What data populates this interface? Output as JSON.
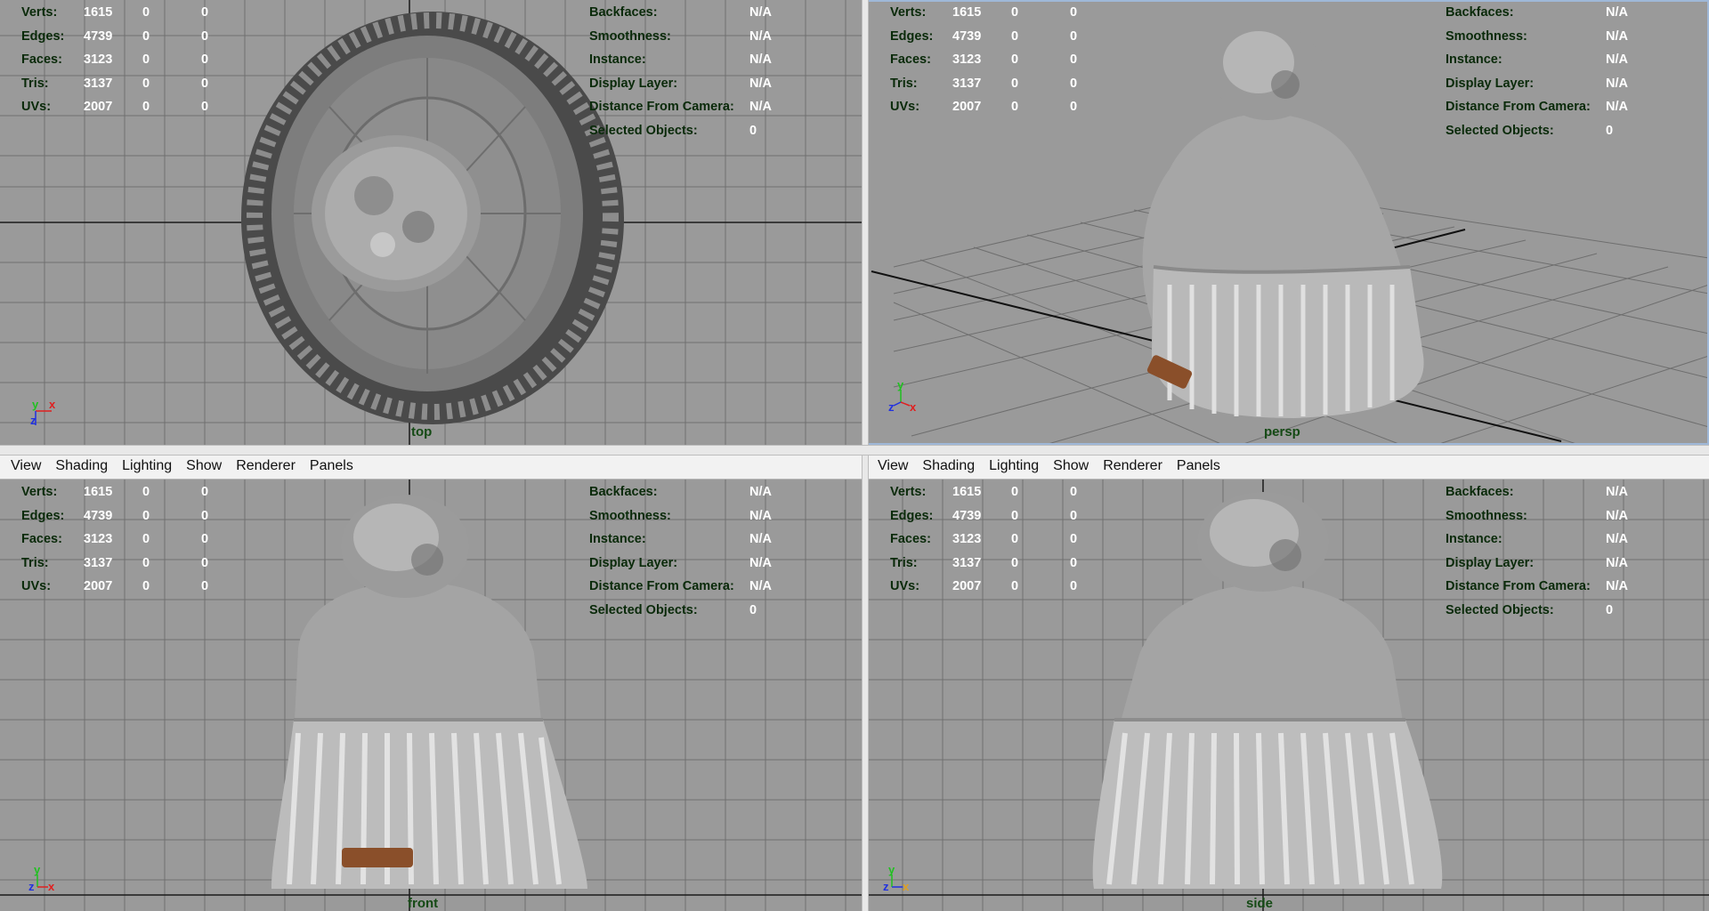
{
  "menu": [
    "View",
    "Shading",
    "Lighting",
    "Show",
    "Renderer",
    "Panels"
  ],
  "hud_left": [
    {
      "label": "Verts:",
      "v1": "1615",
      "v2": "0",
      "v3": "0"
    },
    {
      "label": "Edges:",
      "v1": "4739",
      "v2": "0",
      "v3": "0"
    },
    {
      "label": "Faces:",
      "v1": "3123",
      "v2": "0",
      "v3": "0"
    },
    {
      "label": "Tris:",
      "v1": "3137",
      "v2": "0",
      "v3": "0"
    },
    {
      "label": "UVs:",
      "v1": "2007",
      "v2": "0",
      "v3": "0"
    }
  ],
  "hud_right": [
    {
      "label": "Backfaces:",
      "value": "N/A"
    },
    {
      "label": "Smoothness:",
      "value": "N/A"
    },
    {
      "label": "Instance:",
      "value": "N/A"
    },
    {
      "label": "Display Layer:",
      "value": "N/A"
    },
    {
      "label": "Distance From Camera:",
      "value": "N/A"
    },
    {
      "label": "Selected Objects:",
      "value": "0"
    }
  ],
  "panes": {
    "top": {
      "camera": "top",
      "axis": [
        "y",
        "x",
        "z"
      ]
    },
    "persp": {
      "camera": "persp",
      "axis": [
        "y",
        "z",
        "x"
      ]
    },
    "front": {
      "camera": "front",
      "axis": [
        "y",
        "z",
        "x"
      ]
    },
    "side": {
      "camera": "side",
      "axis": [
        "y",
        "z",
        "x"
      ]
    }
  },
  "colors": {
    "viewport_bg": "#9a9a9a",
    "hud_label": "#0a2a0a",
    "hud_value": "#ffffff",
    "grid_line": "#6e6e6e",
    "axis_x": "#e02020",
    "axis_y": "#20c020",
    "axis_z": "#2030e0",
    "patch": "#8a4f2a"
  }
}
